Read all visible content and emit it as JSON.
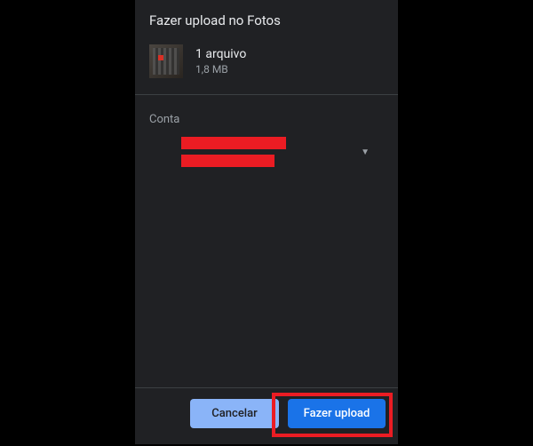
{
  "dialog": {
    "title": "Fazer upload no Fotos"
  },
  "file": {
    "count_label": "1 arquivo",
    "size_label": "1,8 MB"
  },
  "account": {
    "section_label": "Conta"
  },
  "actions": {
    "cancel_label": "Cancelar",
    "upload_label": "Fazer upload"
  }
}
